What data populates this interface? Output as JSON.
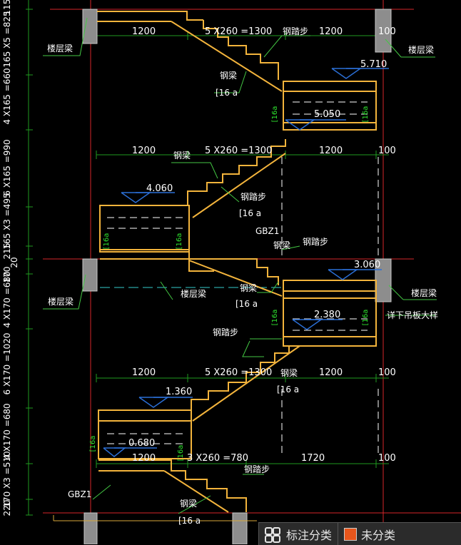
{
  "drawing": {
    "colors": {
      "stair": "#f3b43c",
      "axis": "#d6262a",
      "level": "#2b6fd6",
      "dim": "#1f9a1f",
      "section": "#8d8d8d",
      "slab": "#d8a93a",
      "text": "#ffffff",
      "green_text": "#2fe52f",
      "leader": "#43c643",
      "dashed": "#ffffff",
      "cyan": "#33cccc"
    },
    "flight_dims": [
      "1200",
      "5 X260 =1300",
      "1200",
      "100",
      "1200",
      "5 X260 =1300",
      "1200",
      "100",
      "1200",
      "5 X260 =1300",
      "1200",
      "100",
      "1200",
      "3 X260 =780",
      "1720",
      "100"
    ],
    "levels": [
      "5.710",
      "5.050",
      "4.060",
      "3.060",
      "2.380",
      "1.360",
      "0.680"
    ],
    "labels": [
      "钢踏步",
      "钢梁",
      "[16 a",
      "钢梁",
      "钢踏步",
      "[16 a",
      "钢梁",
      "GBZ1",
      "钢踏步",
      "钢梁",
      "[16 a",
      "楼层梁",
      "钢踏步",
      "钢梁",
      "[16 a",
      "钢踏步",
      "钢梁",
      "[16 a",
      "GBZ1"
    ],
    "beam_labels": [
      "楼层梁",
      "楼层梁",
      "楼层梁",
      "楼层梁",
      "详下吊板大样"
    ],
    "vertical_dims": [
      "115",
      "165 X5 =825",
      "4 X165 =660",
      "6 X165 =990",
      "165 X3 =495",
      "215",
      "170",
      "20",
      "4 X170 =680",
      "6 X170 =1020",
      "4 X170 =680",
      "170 X3 =510",
      "220"
    ],
    "channel_labels": [
      "[16a",
      "[16a",
      "[16a",
      "[16a",
      "[16a",
      "[16a",
      "[16a",
      "[16a"
    ]
  },
  "panel": {
    "annotate_label": "标注分类",
    "icon": "grid-icon",
    "unclassified_label": "未分类",
    "unclassified_color": "#e8561c"
  }
}
